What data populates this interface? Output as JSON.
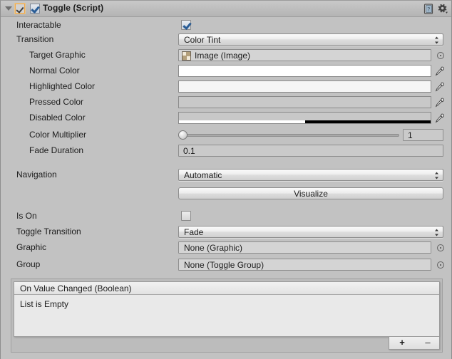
{
  "header": {
    "title": "Toggle (Script)",
    "enabled": true,
    "foldout_expanded": true,
    "help_icon": "help-book-icon",
    "settings_icon": "gear-icon"
  },
  "fields": {
    "interactable": {
      "label": "Interactable",
      "checked": true
    },
    "transition": {
      "label": "Transition",
      "value": "Color Tint"
    },
    "target_graphic": {
      "label": "Target Graphic",
      "value": "Image (Image)"
    },
    "normal_color": {
      "label": "Normal Color",
      "color": "#FFFFFF",
      "alpha": 100
    },
    "highlighted_color": {
      "label": "Highlighted Color",
      "color": "#F5F5F5",
      "alpha": 100
    },
    "pressed_color": {
      "label": "Pressed Color",
      "color": "#C8C8C8",
      "alpha": 100
    },
    "disabled_color": {
      "label": "Disabled Color",
      "color": "#C8C8C8",
      "alpha": 50
    },
    "color_multiplier": {
      "label": "Color Multiplier",
      "value": "1",
      "slider_percent": 0
    },
    "fade_duration": {
      "label": "Fade Duration",
      "value": "0.1"
    },
    "navigation": {
      "label": "Navigation",
      "value": "Automatic"
    },
    "visualize": {
      "label": "Visualize"
    },
    "is_on": {
      "label": "Is On",
      "checked": false
    },
    "toggle_transition": {
      "label": "Toggle Transition",
      "value": "Fade"
    },
    "graphic": {
      "label": "Graphic",
      "value": "None (Graphic)"
    },
    "group": {
      "label": "Group",
      "value": "None (Toggle Group)"
    }
  },
  "event_list": {
    "header": "On Value Changed (Boolean)",
    "empty_message": "List is Empty",
    "add_label": "+",
    "remove_label": "–"
  },
  "colors": {
    "background": "#C2C2C2",
    "accent_orange": "#F0A84C",
    "check_blue": "#2A5D96"
  }
}
